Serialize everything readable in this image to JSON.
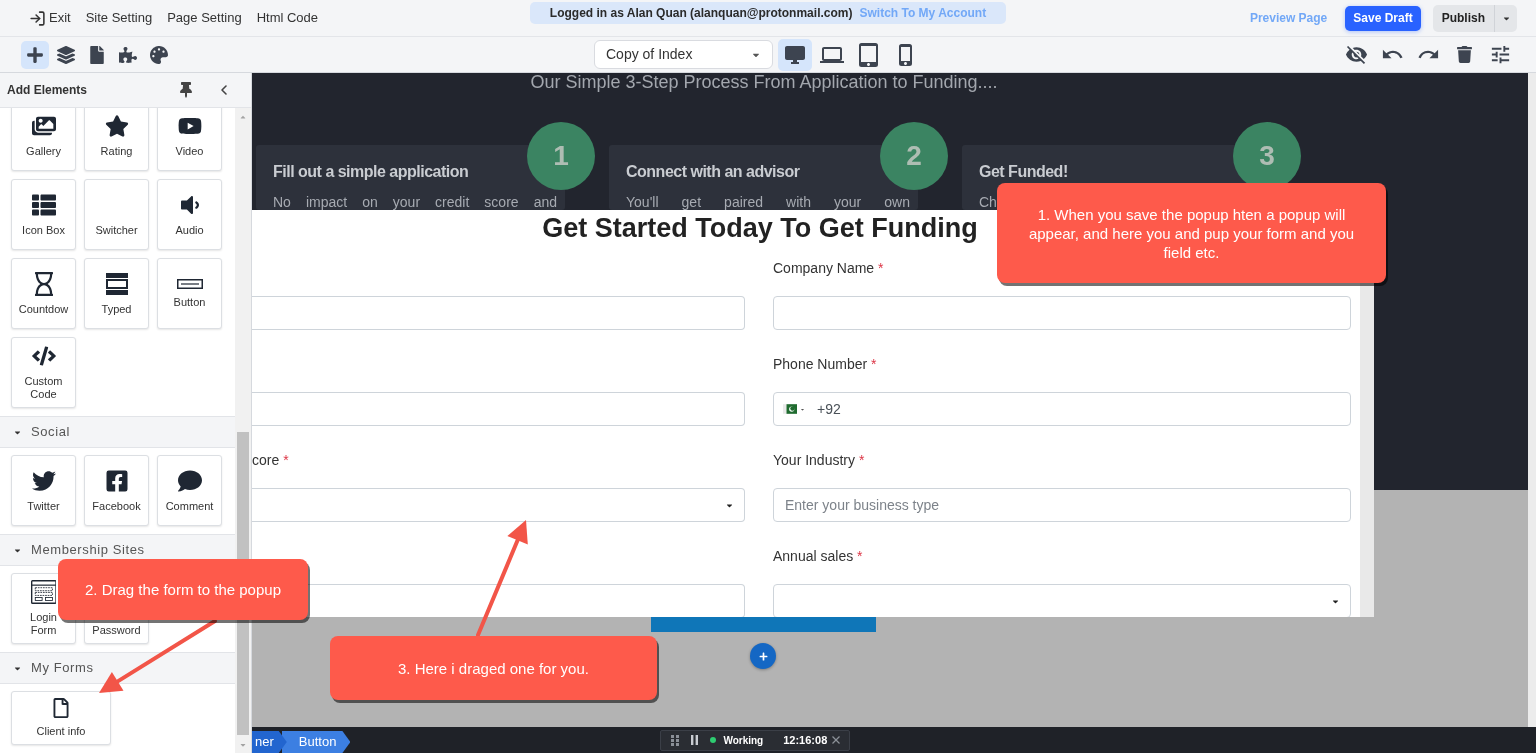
{
  "top_bar": {
    "menu": [
      {
        "kind": "exit",
        "label": "Exit"
      },
      {
        "kind": "link",
        "label": "Site Setting"
      },
      {
        "kind": "link",
        "label": "Page Setting"
      },
      {
        "kind": "link",
        "label": "Html Code"
      }
    ],
    "login_notice": {
      "text": "Logged in as Alan Quan (alanquan@protonmail.com)",
      "link": "Switch To My Account"
    },
    "preview_link": "Preview Page",
    "save_button": "Save Draft",
    "publish_button": "Publish"
  },
  "toolbar": {
    "tools": [
      {
        "kind": "add",
        "selected": true
      },
      {
        "kind": "layers",
        "selected": false
      },
      {
        "kind": "pages",
        "selected": false
      },
      {
        "kind": "plugins",
        "selected": false
      },
      {
        "kind": "theme",
        "selected": false
      }
    ],
    "page_select": {
      "value": "Copy of Index"
    },
    "devices": [
      {
        "kind": "desktop",
        "selected": true
      },
      {
        "kind": "laptop",
        "selected": false
      },
      {
        "kind": "tablet",
        "selected": false
      },
      {
        "kind": "mobile",
        "selected": false
      }
    ],
    "actions": [
      {
        "kind": "hide"
      },
      {
        "kind": "undo"
      },
      {
        "kind": "redo"
      },
      {
        "kind": "delete"
      },
      {
        "kind": "settings"
      }
    ]
  },
  "sidebar": {
    "title": "Add Elements",
    "groups": [
      {
        "items": [
          {
            "kind": "gallery",
            "label": "Gallery"
          },
          {
            "kind": "rating",
            "label": "Rating"
          },
          {
            "kind": "video",
            "label": "Video"
          },
          {
            "kind": "icon_box",
            "label": "Icon Box"
          },
          {
            "kind": "switcher",
            "label": "Switcher"
          },
          {
            "kind": "audio",
            "label": "Audio"
          },
          {
            "kind": "countdown",
            "label": "Countdow"
          },
          {
            "kind": "typed",
            "label": "Typed"
          },
          {
            "kind": "button",
            "label": "Button"
          },
          {
            "kind": "code",
            "label": "Custom Code"
          }
        ]
      },
      {
        "label": "Social",
        "expanded": true,
        "items": [
          {
            "kind": "twitter",
            "label": "Twitter"
          },
          {
            "kind": "facebook",
            "label": "Facebook"
          },
          {
            "kind": "comment",
            "label": "Comment"
          }
        ]
      },
      {
        "label": "Membership Sites",
        "expanded": true,
        "items": [
          {
            "kind": "login",
            "label": "Login Form"
          },
          {
            "kind": "password",
            "label": "Password"
          }
        ]
      },
      {
        "label": "My Forms",
        "expanded": true,
        "items": [
          {
            "kind": "form",
            "label": "Client info"
          }
        ]
      }
    ]
  },
  "canvas": {
    "section_title": "Our Simple 3-Step Process From Application to Funding....",
    "steps": [
      {
        "number": "1",
        "title": "Fill out a simple application",
        "text": "No impact on your credit score and"
      },
      {
        "number": "2",
        "title": "Connect with an advisor",
        "text": "You'll get paired with your own"
      },
      {
        "number": "3",
        "title": "Get Funded!",
        "text": "Ch"
      }
    ],
    "popup": {
      "title": "Get Started Today To Get Funding",
      "columns": [
        [
          {
            "kind": "input"
          },
          {
            "kind": "input"
          },
          {
            "kind": "select",
            "label": "core",
            "required_mark": "*"
          },
          {
            "kind": "input"
          }
        ],
        [
          {
            "kind": "input",
            "label": "Company Name",
            "required_mark": "*"
          },
          {
            "kind": "phone",
            "label": "Phone Number",
            "required_mark": "*",
            "value": "+92"
          },
          {
            "kind": "input",
            "label": "Your Industry",
            "required_mark": "*",
            "placeholder": "Enter your business type"
          },
          {
            "kind": "select",
            "label": "Annual sales",
            "required_mark": "*"
          }
        ]
      ]
    },
    "breadcrumb": [
      {
        "label": "ner",
        "selected": false
      },
      {
        "label": "Button",
        "selected": true
      }
    ],
    "status": {
      "label": "Working",
      "time": "12:16:08"
    }
  },
  "callouts": [
    {
      "text": "1. When you save the popup hten a popup will appear, and here you and pup your form and you field etc."
    },
    {
      "text": "2. Drag the form to the popup"
    },
    {
      "text": "3. Here i draged one for you."
    }
  ]
}
